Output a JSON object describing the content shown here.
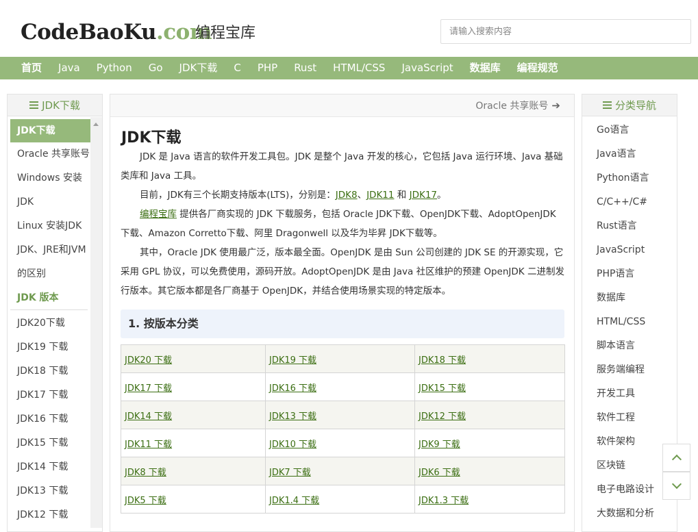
{
  "header": {
    "logo_main": "CodeBaoKu",
    "logo_suffix": ".com",
    "site_name": "编程宝库",
    "search_placeholder": "请输入搜索内容"
  },
  "nav": {
    "items": [
      "首页",
      "Java",
      "Python",
      "Go",
      "JDK下载",
      "C",
      "PHP",
      "Rust",
      "HTML/CSS",
      "JavaScript",
      "数据库",
      "编程规范"
    ]
  },
  "left_sidebar": {
    "title": "JDK下载",
    "items": [
      "JDK下载",
      "Oracle 共享账号",
      "Windows 安装",
      "JDK",
      "Linux 安装JDK",
      "JDK、JRE和JVM",
      "的区别"
    ],
    "category": "JDK 版本",
    "versions": [
      "JDK20下载",
      "JDK19 下载",
      "JDK18 下载",
      "JDK17 下载",
      "JDK16 下载",
      "JDK15 下载",
      "JDK14 下载",
      "JDK13 下载",
      "JDK12 下载"
    ]
  },
  "main": {
    "top_link": "Oracle 共享账号",
    "title": "JDK下载",
    "p1": "JDK 是 Java 语言的软件开发工具包。JDK 是整个 Java 开发的核心，它包括 Java 运行环境、Java 基础类库和 Java 工具。",
    "p2": {
      "pre": "目前，JDK有三个长期支持版本(LTS)，分别是：",
      "l1": "JDK8",
      "s1": "、",
      "l2": "JDK11",
      "s2": " 和 ",
      "l3": "JDK17",
      "post": "。"
    },
    "p3": {
      "link": "编程宝库",
      "text": " 提供各厂商实现的 JDK 下载服务，包括 Oracle JDK下载、OpenJDK下载、AdoptOpenJDK下载、Amazon Corretto下载、阿里 Dragonwell 以及华为毕昇 JDK下载等。"
    },
    "p4": "其中，Oracle JDK 使用最广泛，版本最全面。OpenJDK 是由 Sun 公司创建的 JDK SE 的开源实现，它采用 GPL 协议，可以免费使用，源码开放。AdoptOpenJDK 是由 Java 社区维护的预建 OpenJDK 二进制发行版本。其它版本都是各厂商基于 OpenJDK，并结合使用场景实现的特定版本。",
    "section_title": "1. 按版本分类",
    "table": [
      [
        "JDK20 下载",
        "JDK19 下载",
        "JDK18 下载"
      ],
      [
        "JDK17 下载",
        "JDK16 下载",
        "JDK15 下载"
      ],
      [
        "JDK14 下载",
        "JDK13 下载",
        "JDK12 下载"
      ],
      [
        "JDK11 下载",
        "JDK10 下载",
        "JDK9 下载"
      ],
      [
        "JDK8 下载",
        "JDK7 下载",
        "JDK6 下载"
      ],
      [
        "JDK5 下载",
        "JDK1.4 下载",
        "JDK1.3 下载"
      ]
    ]
  },
  "right_sidebar": {
    "title": "分类导航",
    "items": [
      "Go语言",
      "Java语言",
      "Python语言",
      "C/C++/C#",
      "Rust语言",
      "JavaScript",
      "PHP语言",
      "数据库",
      "HTML/CSS",
      "脚本语言",
      "服务端编程",
      "开发工具",
      "软件工程",
      "软件架构",
      "区块链",
      "电子电路设计",
      "大数据和分析"
    ]
  },
  "colors": {
    "brand_green": "#96b97b",
    "link_green": "#3b6e12"
  }
}
